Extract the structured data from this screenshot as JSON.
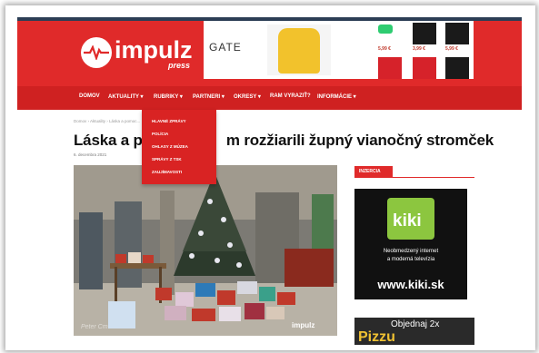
{
  "header": {
    "logo_text": "impulz",
    "logo_sub": "press",
    "ad_brand": "GATE",
    "ad_prices": [
      "5,99 €",
      "3,99 €",
      "5,99 €"
    ]
  },
  "nav": {
    "items": [
      "DOMOV",
      "AKTUALITY ▾",
      "RUBRIKY ▾",
      "PARTNERI ▾",
      "OKRESY ▾",
      "RAM VYRAZIŤ?",
      "INFORMÁCIE ▾"
    ]
  },
  "dropdown": {
    "items": [
      "HLAVNÉ ZPRÁVY",
      "POLÍCIA",
      "OHLASY Z MÚZEA",
      "SPRÁVY Z TSK",
      "ZAUJÍMAVOSTI"
    ]
  },
  "article": {
    "breadcrumb": "Domov › Aktuality › Láska a pomoc...",
    "title": "Láska a po",
    "title_rest": "m rozžiarili župný vianočný stromček",
    "date": "6. decembra 2021",
    "photo_caption": "Peter Cm",
    "watermark": "impulz"
  },
  "sidebar": {
    "label": "INZERCIA",
    "kiki": {
      "logo_text": "kiki",
      "line1": "Neobmedzený internet",
      "line2": "a moderná televízia",
      "url": "www.kiki.sk"
    },
    "pizza": {
      "text": "Objednaj 2x",
      "word": "Pizzu"
    }
  },
  "colors": {
    "brand_red": "#e02a2a",
    "nav_red": "#cf2121",
    "kiki_green": "#8cc63f"
  }
}
